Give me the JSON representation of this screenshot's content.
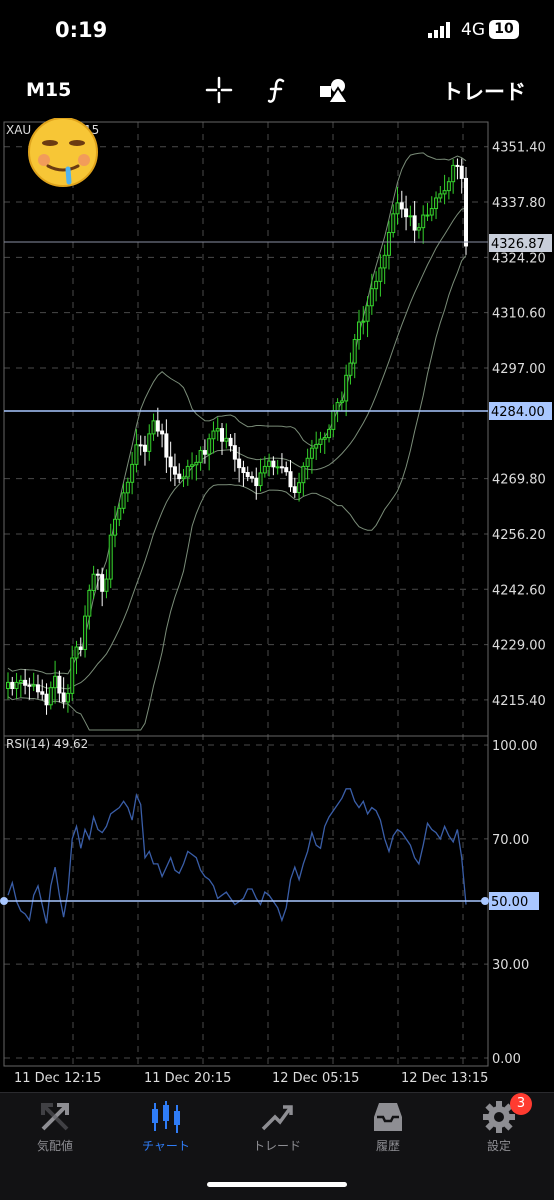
{
  "status": {
    "time": "0:19",
    "network": "4G",
    "battery": "10"
  },
  "toolbar": {
    "timeframe": "M15",
    "trade_label": "トレード",
    "icons": [
      "crosshair-icon",
      "function-icon",
      "objects-icon"
    ]
  },
  "chart": {
    "symbol_label": "XAU",
    "symbol_suffix": "15",
    "sticker": "drooling-face-emoji",
    "current_price_label": "4326.87",
    "level_label": "4284.00",
    "price_ticks": [
      "4351.40",
      "4337.80",
      "4324.20",
      "4310.60",
      "4297.00",
      "4269.80",
      "4256.20",
      "4242.60",
      "4229.00",
      "4215.40"
    ],
    "rsi_label": "RSI(14) 49.62",
    "rsi_ticks": [
      "100.00",
      "70.00",
      "30.00",
      "0.00"
    ],
    "rsi_level_label": "50.00",
    "time_ticks": [
      "11 Dec 12:15",
      "11 Dec 20:15",
      "12 Dec 05:15",
      "12 Dec 13:15"
    ]
  },
  "chart_data": {
    "type": "candlestick",
    "price_range": [
      4208,
      4356
    ],
    "rsi_range": [
      0,
      100
    ],
    "x_count": 108,
    "closes": [
      4219.7,
      4218.2,
      4219.7,
      4220.2,
      4219.0,
      4218.8,
      4219.1,
      4217.4,
      4216.8,
      4214.2,
      4218.4,
      4221.2,
      4217.1,
      4214.9,
      4217.0,
      4225.7,
      4228.4,
      4227.8,
      4236.0,
      4242.3,
      4246.3,
      4246.2,
      4242.1,
      4245.1,
      4255.9,
      4259.8,
      4262.5,
      4266.3,
      4268.9,
      4273.3,
      4278.1,
      4278.0,
      4276.5,
      4280.8,
      4284.0,
      4281.5,
      4280.8,
      4275.1,
      4272.7,
      4270.9,
      4269.8,
      4270.2,
      4272.8,
      4273.2,
      4273.8,
      4276.7,
      4275.8,
      4279.6,
      4281.5,
      4282.1,
      4279.0,
      4279.7,
      4277.9,
      4274.6,
      4272.5,
      4271.3,
      4270.3,
      4269.9,
      4268.1,
      4271.2,
      4272.8,
      4274.1,
      4272.7,
      4272.7,
      4272.5,
      4271.5,
      4267.8,
      4266.4,
      4268.8,
      4272.8,
      4274.8,
      4277.3,
      4278.2,
      4279.5,
      4279.9,
      4281.9,
      4286.5,
      4288.5,
      4288.9,
      4295.2,
      4298.2,
      4304.0,
      4308.3,
      4308.5,
      4312.3,
      4316.5,
      4318.3,
      4321.6,
      4324.7,
      4330.3,
      4334.9,
      4337.6,
      4336.1,
      4334.2,
      4334.4,
      4330.9,
      4331.5,
      4334.6,
      4334.6,
      4336.2,
      4338.8,
      4339.8,
      4340.6,
      4342.8,
      4346.8,
      4346.6,
      4343.6,
      4327.0
    ],
    "bands": {
      "upper_start": 4226,
      "upper_peak": 4300,
      "lower_start": 4212,
      "middle": "moving-average"
    },
    "rsi_values": [
      52,
      56,
      50,
      47,
      46,
      44,
      52,
      55,
      49,
      43,
      55,
      61,
      52,
      45,
      53,
      70,
      74,
      67,
      73,
      70,
      77,
      73,
      72,
      74,
      78,
      79,
      80,
      82,
      80,
      76,
      84,
      81,
      64,
      66,
      62,
      62,
      58,
      61,
      64,
      60,
      59,
      62,
      66,
      65,
      64,
      60,
      58,
      57,
      55,
      51,
      52,
      53,
      51,
      49,
      50,
      51,
      54,
      54,
      51,
      49,
      53,
      52,
      50,
      48,
      44,
      48,
      57,
      61,
      57,
      62,
      66,
      72,
      68,
      67,
      74,
      77,
      79,
      81,
      83,
      86,
      86,
      82,
      80,
      82,
      78,
      80,
      79,
      76,
      70,
      66,
      71,
      73,
      72,
      70,
      68,
      64,
      62,
      68,
      75,
      73,
      72,
      70,
      74,
      71,
      69,
      73,
      64,
      49
    ],
    "levels": {
      "price": 4284.0,
      "rsi": 50
    }
  },
  "colors": {
    "bull": "#35d12c",
    "bear": "#ffffff",
    "rsi": "#3a5ea8",
    "level": "#a9c7ff",
    "grid": "#4a4a4a",
    "active_tab": "#2f7cf6",
    "badge": "#ff3b30"
  },
  "tabs": [
    {
      "label": "気配値",
      "icon": "quotes-icon",
      "active": false
    },
    {
      "label": "チャート",
      "icon": "chart-icon",
      "active": true
    },
    {
      "label": "トレード",
      "icon": "trade-icon",
      "active": false
    },
    {
      "label": "履歴",
      "icon": "history-icon",
      "active": false
    },
    {
      "label": "設定",
      "icon": "settings-icon",
      "active": false,
      "badge": "3"
    }
  ]
}
